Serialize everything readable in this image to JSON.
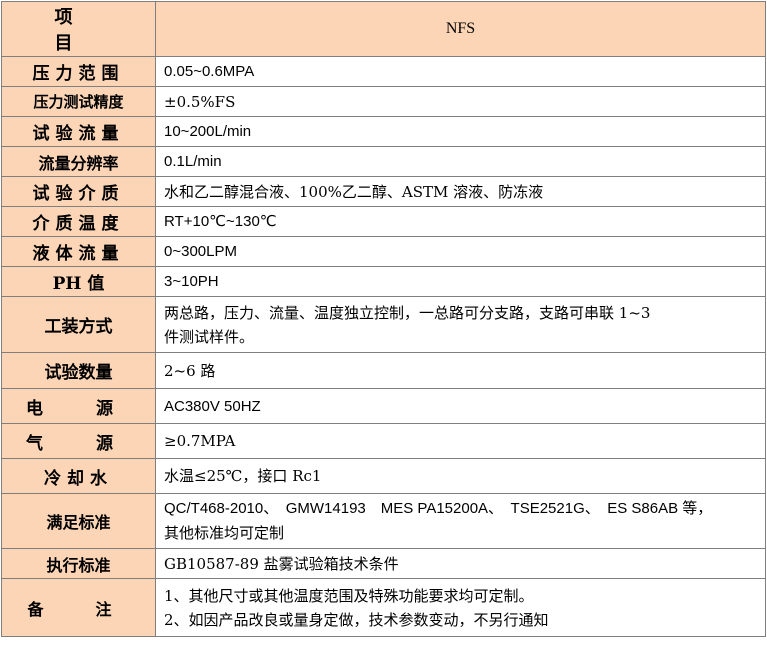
{
  "header": {
    "item_label": "项　目",
    "model": "NFS"
  },
  "rows": [
    {
      "label": "压力范围",
      "value": "0.05~0.6MPA"
    },
    {
      "label": "压力测试精度",
      "value": "±0.5%FS"
    },
    {
      "label": "试验流量",
      "value": "10~200L/min"
    },
    {
      "label": "流量分辨率",
      "value": "0.1L/min"
    },
    {
      "label": "试验介质",
      "value": "水和乙二醇混合液、100%乙二醇、ASTM 溶液、防冻液"
    },
    {
      "label": "介质温度",
      "value": "RT+10℃~130℃"
    },
    {
      "label": "液体流量",
      "value": "0~300LPM"
    },
    {
      "label": "PH 值",
      "value": "3~10PH"
    },
    {
      "label": "工装方式",
      "value_line1": "两总路，压力、流量、温度独立控制，一总路可分支路，支路可串联 1~3",
      "value_line2": "件测试样件。"
    },
    {
      "label": "试验数量",
      "value": "2~6 路"
    },
    {
      "label": "电　源",
      "value": "AC380V 50HZ"
    },
    {
      "label": "气　源",
      "value": "≥0.7MPA"
    },
    {
      "label": "冷却水",
      "value": "水温≤25℃，接口 Rc1"
    },
    {
      "label": "满足标准",
      "value_line1": "QC/T468-2010、　GMW14193　MES PA15200A、　TSE2521G、　ES S86AB 等，",
      "value_line2": "其他标准均可定制"
    },
    {
      "label": "执行标准",
      "value": "GB10587-89 盐雾试验箱技术条件"
    },
    {
      "label": "备　注",
      "value_line1": "1、其他尺寸或其他温度范围及特殊功能要求均可定制。",
      "value_line2": "2、如因产品改良或量身定做，技术参数变动，不另行通知"
    }
  ]
}
